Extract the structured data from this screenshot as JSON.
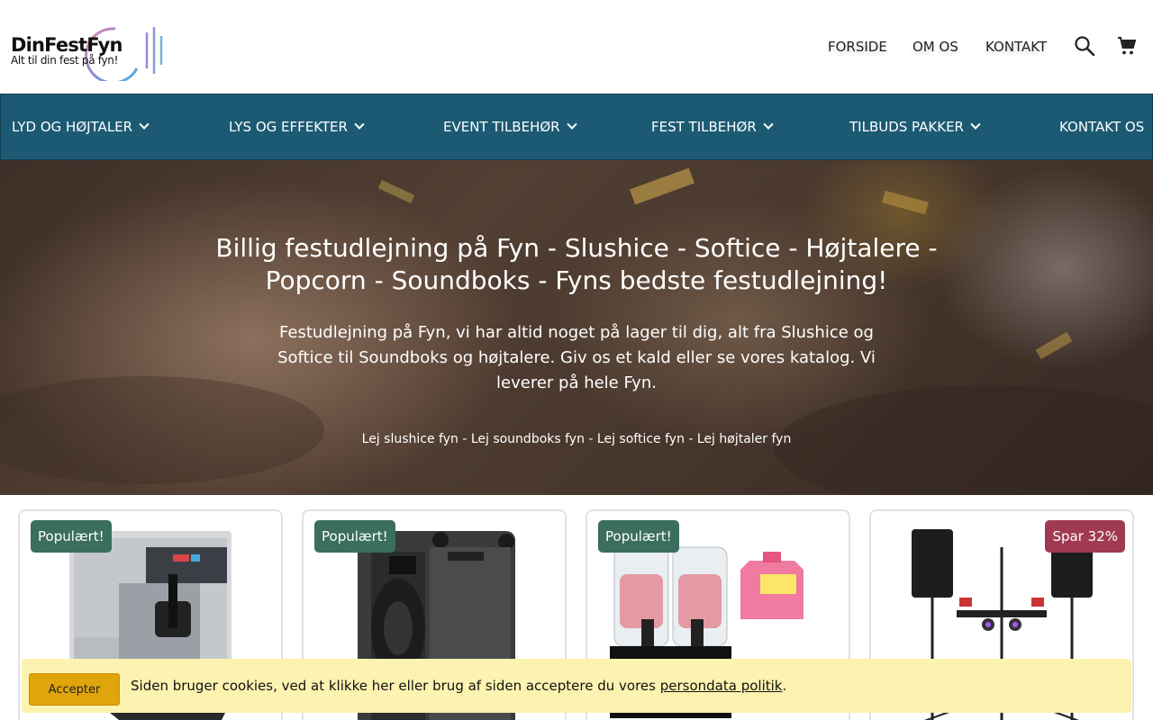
{
  "logo": {
    "title": "DinFestFyn",
    "subtitle": "Alt til din fest på fyn!"
  },
  "topnav": {
    "items": [
      "FORSIDE",
      "OM OS",
      "KONTAKT"
    ]
  },
  "mainnav": {
    "items": [
      {
        "label": "LYD OG HØJTALER",
        "has_dropdown": true
      },
      {
        "label": "LYS OG EFFEKTER",
        "has_dropdown": true
      },
      {
        "label": "EVENT TILBEHØR",
        "has_dropdown": true
      },
      {
        "label": "FEST TILBEHØR",
        "has_dropdown": true
      },
      {
        "label": "TILBUDS PAKKER",
        "has_dropdown": true
      },
      {
        "label": "KONTAKT OS",
        "has_dropdown": false
      }
    ]
  },
  "hero": {
    "title": "Billig festudlejning på Fyn - Slushice - Softice - Højtalere - Popcorn - Soundboks - Fyns bedste festudlejning!",
    "text": "Festudlejning på Fyn, vi har altid noget på lager til dig, alt fra Slushice og Softice til Soundboks og højtalere. Giv os et kald eller se vores katalog. Vi leverer på hele Fyn.",
    "links": "Lej slushice fyn - Lej soundboks fyn - Lej softice fyn - Lej højtaler fyn"
  },
  "products": [
    {
      "badge": "Populært!",
      "badge_type": "green",
      "image": "softice-machine"
    },
    {
      "badge": "Populært!",
      "badge_type": "green",
      "image": "soundboks-speaker"
    },
    {
      "badge": "Populært!",
      "badge_type": "green",
      "image": "slushice-machine"
    },
    {
      "badge": "Spar 32%",
      "badge_type": "red",
      "image": "speaker-light-package"
    }
  ],
  "cookie": {
    "button": "Accepter",
    "text": "Siden bruger cookies, ved at klikke her eller brug af siden acceptere du vores ",
    "link": "persondata politik",
    "suffix": "."
  },
  "colors": {
    "nav_bg": "#1c5a73",
    "badge_green": "#3b6e5e",
    "badge_red": "#a03a52",
    "cookie_bg": "#fdf3b0",
    "cookie_button": "#e0a40c"
  }
}
